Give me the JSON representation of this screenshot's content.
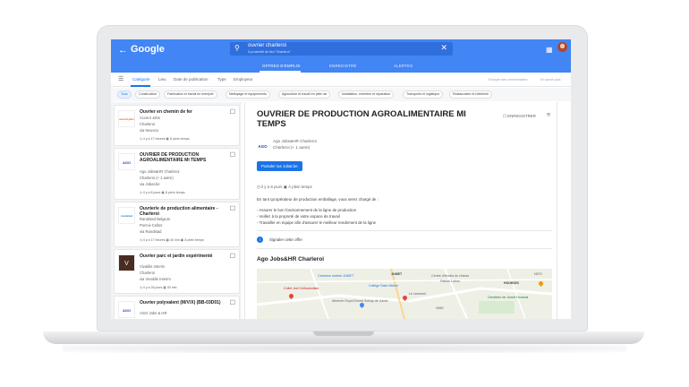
{
  "header": {
    "logo": "Google",
    "search_value": "ouvrier charleroi",
    "search_sub": "À proximité du lieu \"Charleroi\"",
    "tabs": [
      {
        "label": "OFFRES D'EMPLOI",
        "active": true
      },
      {
        "label": "ENREGISTRÉ",
        "active": false
      },
      {
        "label": "ALERTES",
        "active": false
      }
    ]
  },
  "filters": {
    "items": [
      "Catégorie",
      "Lieu",
      "Date de publication",
      "Type",
      "Employeur"
    ],
    "active_index": 0,
    "right_links": [
      "Envoyer des commentaires",
      "En savoir plus"
    ]
  },
  "chips": [
    {
      "label": "Tous",
      "active": true
    },
    {
      "label": "Construction",
      "active": false
    },
    {
      "label": "Fabrication et travail en entrepôt",
      "active": false
    },
    {
      "label": "Nettoyage et équipements",
      "active": false
    },
    {
      "label": "Agriculture et travail en plein air",
      "active": false
    },
    {
      "label": "Installation, entretien et réparation",
      "active": false
    },
    {
      "label": "Transports et logistique",
      "active": false
    },
    {
      "label": "Restauration et hôtellerie",
      "active": false
    }
  ],
  "jobs": [
    {
      "title": "Ouvrier en chemin de fer",
      "company": "Accent Jobs",
      "location": "Charleroi",
      "via": "via Neuvoo",
      "posted": "il y a 17 heures",
      "type": "À plein temps",
      "distance": "",
      "logo_text": "accent jobs"
    },
    {
      "title": "OUVRIER DE PRODUCTION AGROALIMENTAIRE MI TEMPS",
      "company": "Ago Jobs&HR Charleroi",
      "location": "Charleroi (+ 1 autre)",
      "via": "via Jobat.be",
      "posted": "il y a 8 jours",
      "type": "À plein temps",
      "distance": "",
      "logo_text": "AGO"
    },
    {
      "title": "Ouvrier/e de production alimentaire - Charleroi",
      "company": "Randstad Belgium",
      "location": "Pont-à-Celles",
      "via": "via Randstad",
      "posted": "il y a 17 heures",
      "type": "À plein temps",
      "distance": "40 min",
      "logo_text": "randstad"
    },
    {
      "title": "Ouvrier parc et jardin expérimenté",
      "company": "Vivaldis Interim",
      "location": "Charleroi",
      "via": "via Vivaldis Interim",
      "posted": "il y a 28 jours",
      "type": "",
      "distance": "30 min",
      "logo_text": "V"
    },
    {
      "title": "Ouvrier polyvalent (M/V/X) (BB-03D01)",
      "company": "AGO Jobs & HR",
      "location": "",
      "via": "",
      "posted": "",
      "type": "",
      "distance": "",
      "logo_text": "AGO"
    }
  ],
  "detail": {
    "title": "OUVRIER DE PRODUCTION AGROALIMENTAIRE MI TEMPS",
    "save_label": "ENREGISTRER",
    "company_logo": "AGO",
    "company": "Ago Jobs&HR Charleroi",
    "location": "Charleroi (+ 1 autre)",
    "apply_label": "Postuler sur Jobat.be",
    "posted": "il y a 8 jours",
    "type": "À plein temps",
    "intro": "En tant qu'opérateur de production emballage, vous serez chargé de :",
    "bullets": [
      "- Assurer le bon fonctionnement de la ligne de production",
      "- Veillez à la propreté de votre espace de travail",
      "- Travailler en équipe afin d'assurer le meilleur rendement de la ligne"
    ],
    "report_label": "Signaler cette offre",
    "section_title": "Ago Jobs&HR Charleroi"
  },
  "map": {
    "labels": [
      {
        "text": "Carrefour market JUMET",
        "style": "link"
      },
      {
        "text": "JUMET",
        "style": "bold"
      },
      {
        "text": "Collège Saint-Michel",
        "style": "link"
      },
      {
        "text": "Centre d'études du réseau",
        "style": ""
      },
      {
        "text": "Patrick Lobos",
        "style": ""
      },
      {
        "text": "HOUBOIS",
        "style": "bold"
      },
      {
        "text": "Collet Joel Orthodontiste",
        "style": "red"
      },
      {
        "text": "Le carnaval",
        "style": ""
      },
      {
        "text": "Athénée Royal Ernest Solvay de Jumet",
        "style": ""
      },
      {
        "text": "Cimetière de Jumet Houbois",
        "style": "green"
      },
      {
        "text": "N582",
        "style": ""
      },
      {
        "text": "N570",
        "style": ""
      }
    ]
  },
  "colors": {
    "brand": "#4285f4",
    "accent": "#1a73e8"
  }
}
